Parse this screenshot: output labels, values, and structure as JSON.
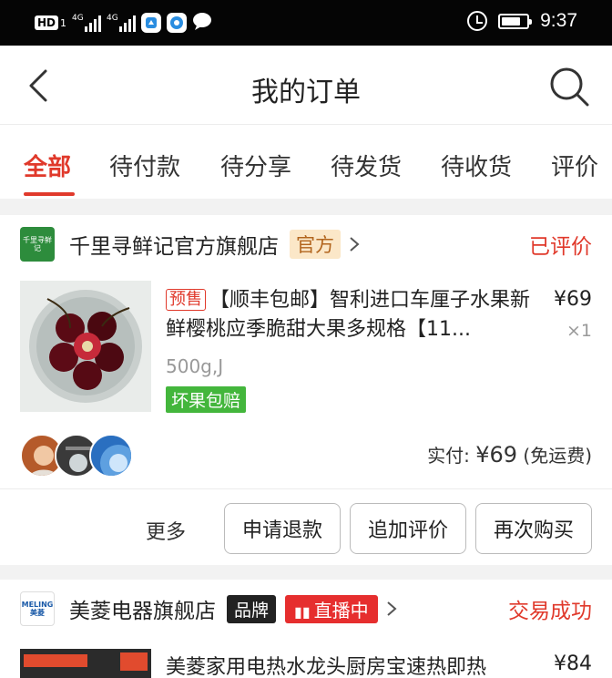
{
  "status_bar": {
    "hd": "HD",
    "sim1": "1",
    "net1": "4G",
    "net2": "4G",
    "time": "9:37",
    "icons": [
      "hd-icon",
      "signal-icon",
      "signal-icon",
      "app-icon",
      "browser-icon",
      "chat-bubble-icon",
      "alarm-icon",
      "battery-icon"
    ]
  },
  "header": {
    "title": "我的订单",
    "back_icon": "chevron-left-icon",
    "search_icon": "search-icon"
  },
  "tabs": [
    {
      "label": "全部",
      "active": true
    },
    {
      "label": "待付款",
      "active": false
    },
    {
      "label": "待分享",
      "active": false
    },
    {
      "label": "待发货",
      "active": false
    },
    {
      "label": "待收货",
      "active": false
    },
    {
      "label": "评价",
      "active": false
    }
  ],
  "orders": [
    {
      "store_logo_text": "千里寻鲜记",
      "store_name": "千里寻鲜记官方旗舰店",
      "store_tag": "官方",
      "status": "已评价",
      "product": {
        "presale_tag": "预售",
        "title": "【顺丰包邮】智利进口车厘子水果新鲜樱桃应季脆甜大果多规格【11...",
        "spec": "500g,J",
        "guarantee": "坏果包赔",
        "price": "¥69",
        "qty": "×1"
      },
      "paid_label": "实付: ",
      "paid_amount": "¥69",
      "paid_note": " (免运费)",
      "more": "更多",
      "buttons": [
        "申请退款",
        "追加评价",
        "再次购买"
      ]
    },
    {
      "store_logo_text": "MELING 美菱",
      "store_name": "美菱电器旗舰店",
      "store_tag": "品牌",
      "live_tag": "直播中",
      "status": "交易成功",
      "product": {
        "title": "美菱家用电热水龙头厨房宝速热即热",
        "price": "¥84"
      }
    }
  ],
  "colors": {
    "accent": "#e0392b",
    "guarantee": "#43b63c",
    "official_tag_bg": "#fbe7c8",
    "live_tag": "#e62e2e"
  }
}
